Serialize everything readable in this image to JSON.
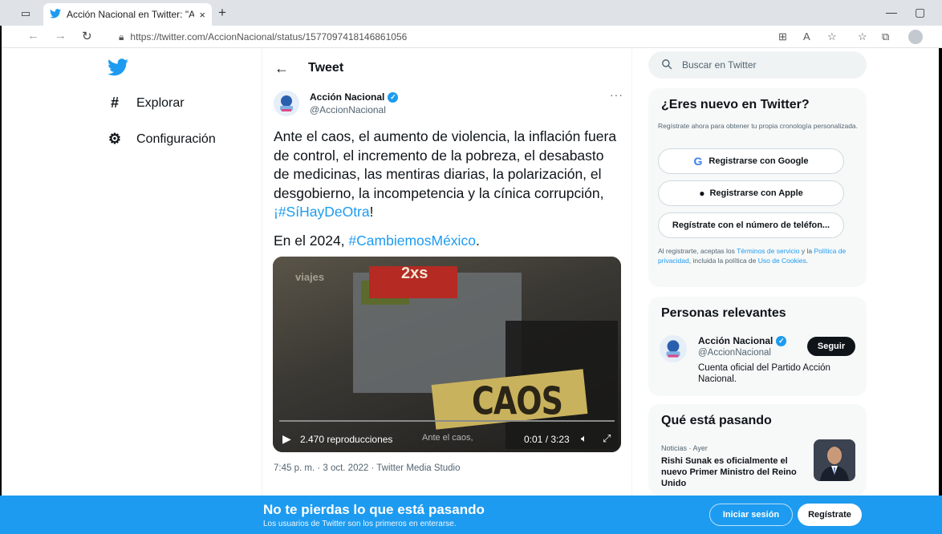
{
  "browser": {
    "tab_title": "Acción Nacional en Twitter: \"Ante",
    "url": "https://twitter.com/AccionNacional/status/1577097418146861056",
    "tab_close": "×",
    "new_tab": "+"
  },
  "nav": {
    "items": [
      {
        "label": "Explorar",
        "icon": "#"
      },
      {
        "label": "Configuración",
        "icon": "⚙"
      }
    ]
  },
  "header": {
    "back": "←",
    "title": "Tweet"
  },
  "tweet": {
    "author_name": "Acción Nacional",
    "author_handle": "@AccionNacional",
    "more": "···",
    "text_main": "Ante el caos, el aumento de violencia, la inflación fuera de control, el incremento de la pobreza, el desabasto de medicinas, las mentiras diarias, la polarización, el desgobierno, la incompetencia y la cínica corrupción, ",
    "text_hashtag1": "¡#SíHayDeOtra",
    "text_after1": "!",
    "text2_prefix": "En el 2024, ",
    "text2_hashtag": "#CambiemosMéxico",
    "text2_suffix": ".",
    "video": {
      "overlay_text": "CAOS",
      "sign_text": "2xs",
      "small_text": "viajes",
      "views": "2.470 reproducciones",
      "caption": "Ante el caos,",
      "time": "0:01 / 3:23",
      "progress": 0.005
    },
    "timestamp": "7:45 p. m. · 3 oct. 2022 · Twitter Media Studio"
  },
  "search": {
    "placeholder": "Buscar en Twitter"
  },
  "signup_card": {
    "title": "¿Eres nuevo en Twitter?",
    "description": "Regístrate ahora para obtener tu propia cronología personalizada.",
    "google_label": "Registrarse con Google",
    "apple_label": "Registrarse con Apple",
    "phone_label": "Regístrate con el número de teléfon...",
    "terms_prefix": "Al registrarte, aceptas los ",
    "terms_link": "Términos de servicio",
    "terms_mid": " y la ",
    "privacy_link": "Política de privacidad",
    "terms_mid2": ", incluida la política de ",
    "cookies_link": "Uso de Cookies",
    "terms_end": "."
  },
  "relevant": {
    "title": "Personas relevantes",
    "name": "Acción Nacional",
    "handle": "@AccionNacional",
    "bio": "Cuenta oficial del Partido Acción Nacional.",
    "follow_label": "Seguir"
  },
  "trending": {
    "title": "Qué está pasando",
    "meta": "Noticias · Ayer",
    "headline": "Rishi Sunak es oficialmente el nuevo Primer Ministro del Reino Unido"
  },
  "banner": {
    "title": "No te pierdas lo que está pasando",
    "subtitle": "Los usuarios de Twitter son los primeros en enterarse.",
    "login_label": "Iniciar sesión",
    "signup_label": "Regístrate"
  },
  "colors": {
    "accent": "#1d9bf0",
    "text": "#0f1419",
    "muted": "#536471"
  }
}
